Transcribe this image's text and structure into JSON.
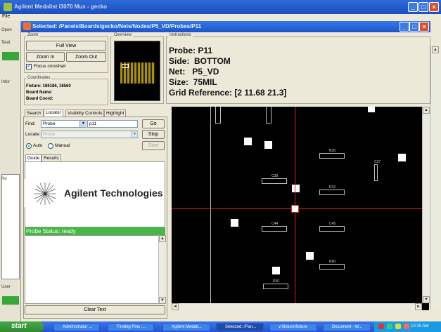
{
  "outer_window": {
    "title": "Agilent Medalist i3070 Mux - gecko",
    "menu": "File"
  },
  "left_strip": {
    "labels": [
      "Open",
      "Testi",
      "Infor",
      "No",
      "User"
    ]
  },
  "inner_window": {
    "title": "Selected: /Panels/Boards/gecko/Nets/Nodes/P5_VD/Probes/P11"
  },
  "zoom": {
    "label": "Zoom",
    "full_view": "Full View",
    "zoom_in": "Zoom In",
    "zoom_out": "Zoom Out",
    "focus_crosshair": "Focus crosshair",
    "focus_checked": true
  },
  "overview": {
    "label": "Overview"
  },
  "coordinates": {
    "label": "Coordinates",
    "fixture": "Fixture: 186186, 18560",
    "board_name": "Board Name:",
    "board_coord": "Board Coord:"
  },
  "instructions": {
    "label": "Instructions",
    "probe": "Probe: P11",
    "side": "Side:  BOTTOM",
    "net": "Net:   P5_VD",
    "size": "Size:  75MIL",
    "grid_ref": "Grid Reference: [2 11.68 21.3]"
  },
  "tabs": [
    "Search",
    "Locator",
    "Visibility Controls",
    "Highlight"
  ],
  "active_tab": "Locator",
  "locator": {
    "find_label": "Find:",
    "find_type": "Probe",
    "find_value": "p11",
    "go": "Go",
    "locate_label": "Locate:",
    "locate_value": "Probe",
    "stop": "Stop",
    "auto": "Auto",
    "manual": "Manual",
    "start": "Start"
  },
  "subtabs": [
    "Guide",
    "Results"
  ],
  "logo_text": "Agilent Technologies",
  "probe_status": "Probe Status: ready",
  "clear_text": "Clear Text",
  "canvas": {
    "components": [
      "R30",
      "C37",
      "C38",
      "R32",
      "C44",
      "C45",
      "R60",
      "R30"
    ],
    "colors": {
      "background": "#000000",
      "crosshair": "#e02020",
      "pad": "#ffffff"
    }
  },
  "taskbar": {
    "start": "start",
    "tasks": [
      "Administrator ...",
      "Finding Pins :...",
      "Agilent Medali...",
      "Selected: /Pan...",
      "v:\\fixture\\fixture",
      "Document - W..."
    ],
    "clock": "10:15 AM"
  }
}
